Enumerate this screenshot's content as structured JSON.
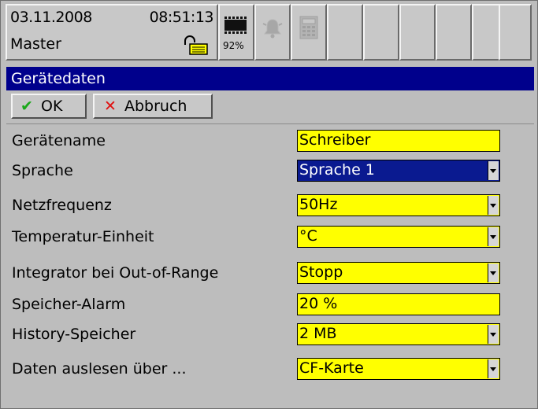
{
  "status": {
    "date": "03.11.2008",
    "time": "08:51:13",
    "user": "Master",
    "memory_percent_label": "92%",
    "icons": [
      "lock-icon",
      "memory-chip-icon",
      "alarm-bell-icon",
      "calculator-icon"
    ]
  },
  "dialog": {
    "title": "Gerätedaten",
    "ok_label": "OK",
    "cancel_label": "Abbruch",
    "fields": [
      {
        "label": "Gerätename",
        "value": "Schreiber",
        "dropdown": false,
        "selected": false
      },
      {
        "label": "Sprache",
        "value": "Sprache 1",
        "dropdown": true,
        "selected": true
      },
      {
        "label": "Netzfrequenz",
        "value": "50Hz",
        "dropdown": true,
        "selected": false
      },
      {
        "label": "Temperatur-Einheit",
        "value": "°C",
        "dropdown": true,
        "selected": false
      },
      {
        "label": "Integrator bei Out-of-Range",
        "value": "Stopp",
        "dropdown": true,
        "selected": false
      },
      {
        "label": "Speicher-Alarm",
        "value": "20 %",
        "dropdown": false,
        "selected": false
      },
      {
        "label": "History-Speicher",
        "value": "2 MB",
        "dropdown": true,
        "selected": false
      },
      {
        "label": "Daten auslesen über ...",
        "value": "CF-Karte",
        "dropdown": true,
        "selected": false
      }
    ]
  },
  "colors": {
    "title_bar": "#00008c",
    "field_bg": "#ffff00",
    "selected_field_bg": "#0a1a90",
    "ok_check": "#1aa81a",
    "cancel_x": "#e01010"
  }
}
